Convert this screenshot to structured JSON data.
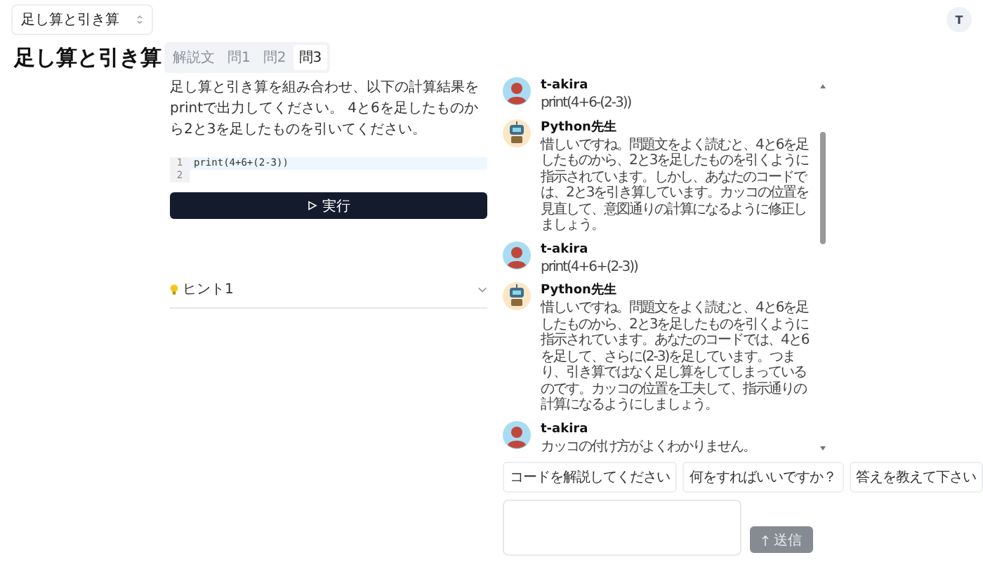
{
  "lesson_select": {
    "value": "足し算と引き算"
  },
  "user_avatar": {
    "initial": "T"
  },
  "title": "足し算と引き算",
  "tabs": [
    {
      "label": "解説文",
      "selected": false
    },
    {
      "label": "問1",
      "selected": false
    },
    {
      "label": "問2",
      "selected": false
    },
    {
      "label": "問3",
      "selected": true
    }
  ],
  "problem": "足し算と引き算を組み合わせ、以下の計算結果をprintで出力してください。 4と6を足したものから2と3を足したものを引いてください。",
  "editor": {
    "lines": [
      {
        "number": "1",
        "code": "print(4+6+(2-3))"
      },
      {
        "number": "2"
      }
    ]
  },
  "run_button": {
    "label": "実行"
  },
  "hints": [
    {
      "label": "ヒント1",
      "expanded": false
    }
  ],
  "chat": {
    "messages": [
      {
        "kind": "user",
        "name": "t-akira",
        "text": "print(4+6-(2-3))"
      },
      {
        "kind": "bot",
        "name": "Python先生",
        "text": "惜しいですね。問題文をよく読むと、4と6を足したものから、2と3を足したものを引くように指示されています。しかし、あなたのコードでは、2と3を引き算しています。カッコの位置を見直して、意図通りの計算になるように修正しましょう。"
      },
      {
        "kind": "user",
        "name": "t-akira",
        "text": "print(4+6+(2-3))"
      },
      {
        "kind": "bot",
        "name": "Python先生",
        "text": "惜しいですね。問題文をよく読むと、4と6を足したものから、2と3を足したものを引くように指示されています。あなたのコードでは、4と6を足して、さらに(2-3)を足しています。つまり、引き算ではなく足し算をしてしまっているのです。カッコの位置を工夫して、指示通りの計算になるようにしましょう。"
      },
      {
        "kind": "user",
        "name": "t-akira",
        "text": "カッコの付け方がよくわかりません。"
      }
    ]
  },
  "quick_replies": [
    "コードを解説してください",
    "何をすればいいですか？",
    "答えを教えて下さい"
  ],
  "send_button": {
    "label": "送信",
    "disabled": true
  }
}
